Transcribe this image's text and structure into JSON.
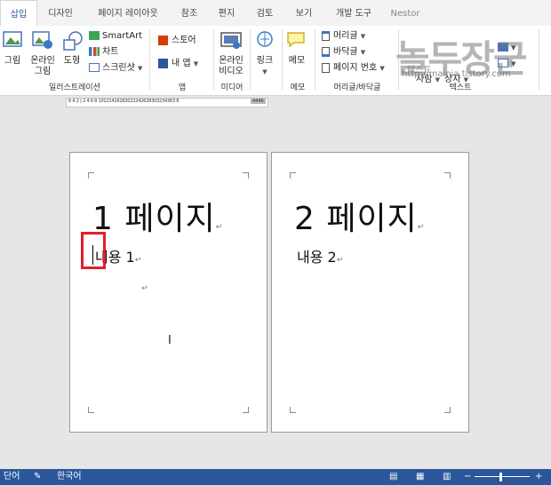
{
  "tabs": [
    "삽입",
    "디자인",
    "페이지 레이아웃",
    "참조",
    "편지",
    "검토",
    "보기",
    "개발 도구",
    "Nestor"
  ],
  "ribbon": {
    "illustrations": {
      "picture": "그림",
      "online_picture": [
        "온라인",
        "그림"
      ],
      "shapes": "도형",
      "smartart": "SmartArt",
      "chart": "차트",
      "screenshot": "스크린샷",
      "group_label": "일러스트레이션"
    },
    "apps": {
      "store": "스토어",
      "my_apps": "내 앱",
      "group_label": "앱"
    },
    "media": {
      "online_video": [
        "온라인",
        "비디오"
      ],
      "group_label": "미디어"
    },
    "links": {
      "link": "링크"
    },
    "comments": {
      "memo": "메모",
      "group_label": "메모"
    },
    "header_footer": {
      "header": "머리글",
      "footer": "바닥글",
      "page_number": "페이지 번호",
      "group_label": "머리글/바닥글"
    },
    "text": {
      "row1": "텍스트",
      "row2a": "빠른",
      "row2b": "문서",
      "row3a": "사람",
      "row3b": "상자",
      "group_label": "텍스트"
    }
  },
  "watermark": {
    "title": "놀두장군",
    "url": "http://mainia.tistory.com"
  },
  "ruler": {
    "text": "6 4 2 | 2 4 6 8 10121416182022242628303234363 8",
    "end": "4446"
  },
  "pages": [
    {
      "title": "1 페이지",
      "body": "내용 1"
    },
    {
      "title": "2 페이지",
      "body": "내용 2"
    }
  ],
  "marks": {
    "para": "↵"
  },
  "status": {
    "words": "단어",
    "language": "한국어"
  },
  "colors": {
    "accent": "#2b579a",
    "highlight": "#e0202a",
    "ribbon_bg": "#ffffff",
    "workspace": "#e6e6e6"
  }
}
